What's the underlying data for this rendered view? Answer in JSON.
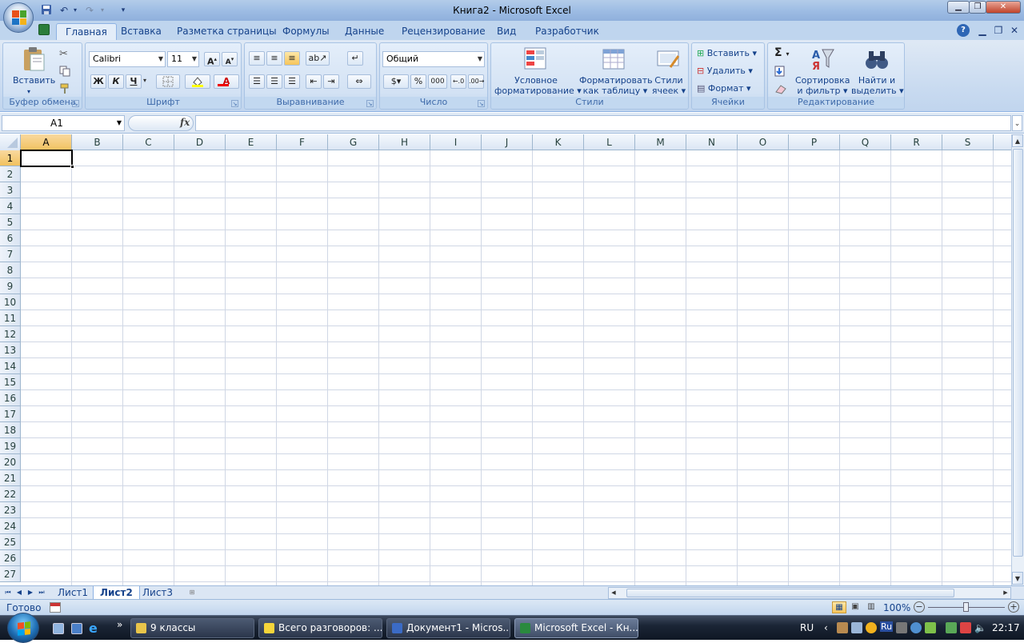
{
  "window": {
    "title": "Книга2 - Microsoft Excel"
  },
  "tabs": [
    "Главная",
    "Вставка",
    "Разметка страницы",
    "Формулы",
    "Данные",
    "Рецензирование",
    "Вид",
    "Разработчик"
  ],
  "ribbon": {
    "clipboard": {
      "label": "Буфер обмена",
      "paste": "Вставить"
    },
    "font": {
      "label": "Шрифт",
      "font_name": "Calibri",
      "font_size": "11",
      "bold": "Ж",
      "italic": "К",
      "underline": "Ч"
    },
    "alignment": {
      "label": "Выравнивание"
    },
    "number": {
      "label": "Число",
      "format": "Общий",
      "percent": "%",
      "thousands": "000"
    },
    "styles": {
      "label": "Стили",
      "conditional": [
        "Условное",
        "форматирование"
      ],
      "format_table": [
        "Форматировать",
        "как таблицу"
      ],
      "cell_styles": [
        "Стили",
        "ячеек"
      ]
    },
    "cells": {
      "label": "Ячейки",
      "insert": "Вставить",
      "delete": "Удалить",
      "format": "Формат"
    },
    "editing": {
      "label": "Редактирование",
      "sort": [
        "Сортировка",
        "и фильтр"
      ],
      "find": [
        "Найти и",
        "выделить"
      ]
    }
  },
  "formula_bar": {
    "name_box": "A1",
    "fx": "fx",
    "formula": ""
  },
  "grid": {
    "columns": [
      "A",
      "B",
      "C",
      "D",
      "E",
      "F",
      "G",
      "H",
      "I",
      "J",
      "K",
      "L",
      "M",
      "N",
      "O",
      "P",
      "Q",
      "R",
      "S"
    ],
    "rows": [
      "1",
      "2",
      "3",
      "4",
      "5",
      "6",
      "7",
      "8",
      "9",
      "10",
      "11",
      "12",
      "13",
      "14",
      "15",
      "16",
      "17",
      "18",
      "19",
      "20",
      "21",
      "22",
      "23",
      "24",
      "25",
      "26",
      "27"
    ],
    "active_cell": "A1"
  },
  "sheets": {
    "tabs": [
      "Лист1",
      "Лист2",
      "Лист3"
    ],
    "active": "Лист2"
  },
  "status": {
    "ready": "Готово",
    "zoom": "100%"
  },
  "taskbar": {
    "buttons": [
      "9 классы",
      "Всего разговоров: ...",
      "Документ1 - Micros...",
      "Microsoft Excel - Кн..."
    ],
    "active": "Microsoft Excel - Кн...",
    "lang": "RU",
    "tray_lang": "Ru",
    "clock": "22:17"
  },
  "colors": {
    "accent": "#15428b",
    "selected_header": "#f1c15f",
    "grid_line": "#d0d7e5"
  }
}
